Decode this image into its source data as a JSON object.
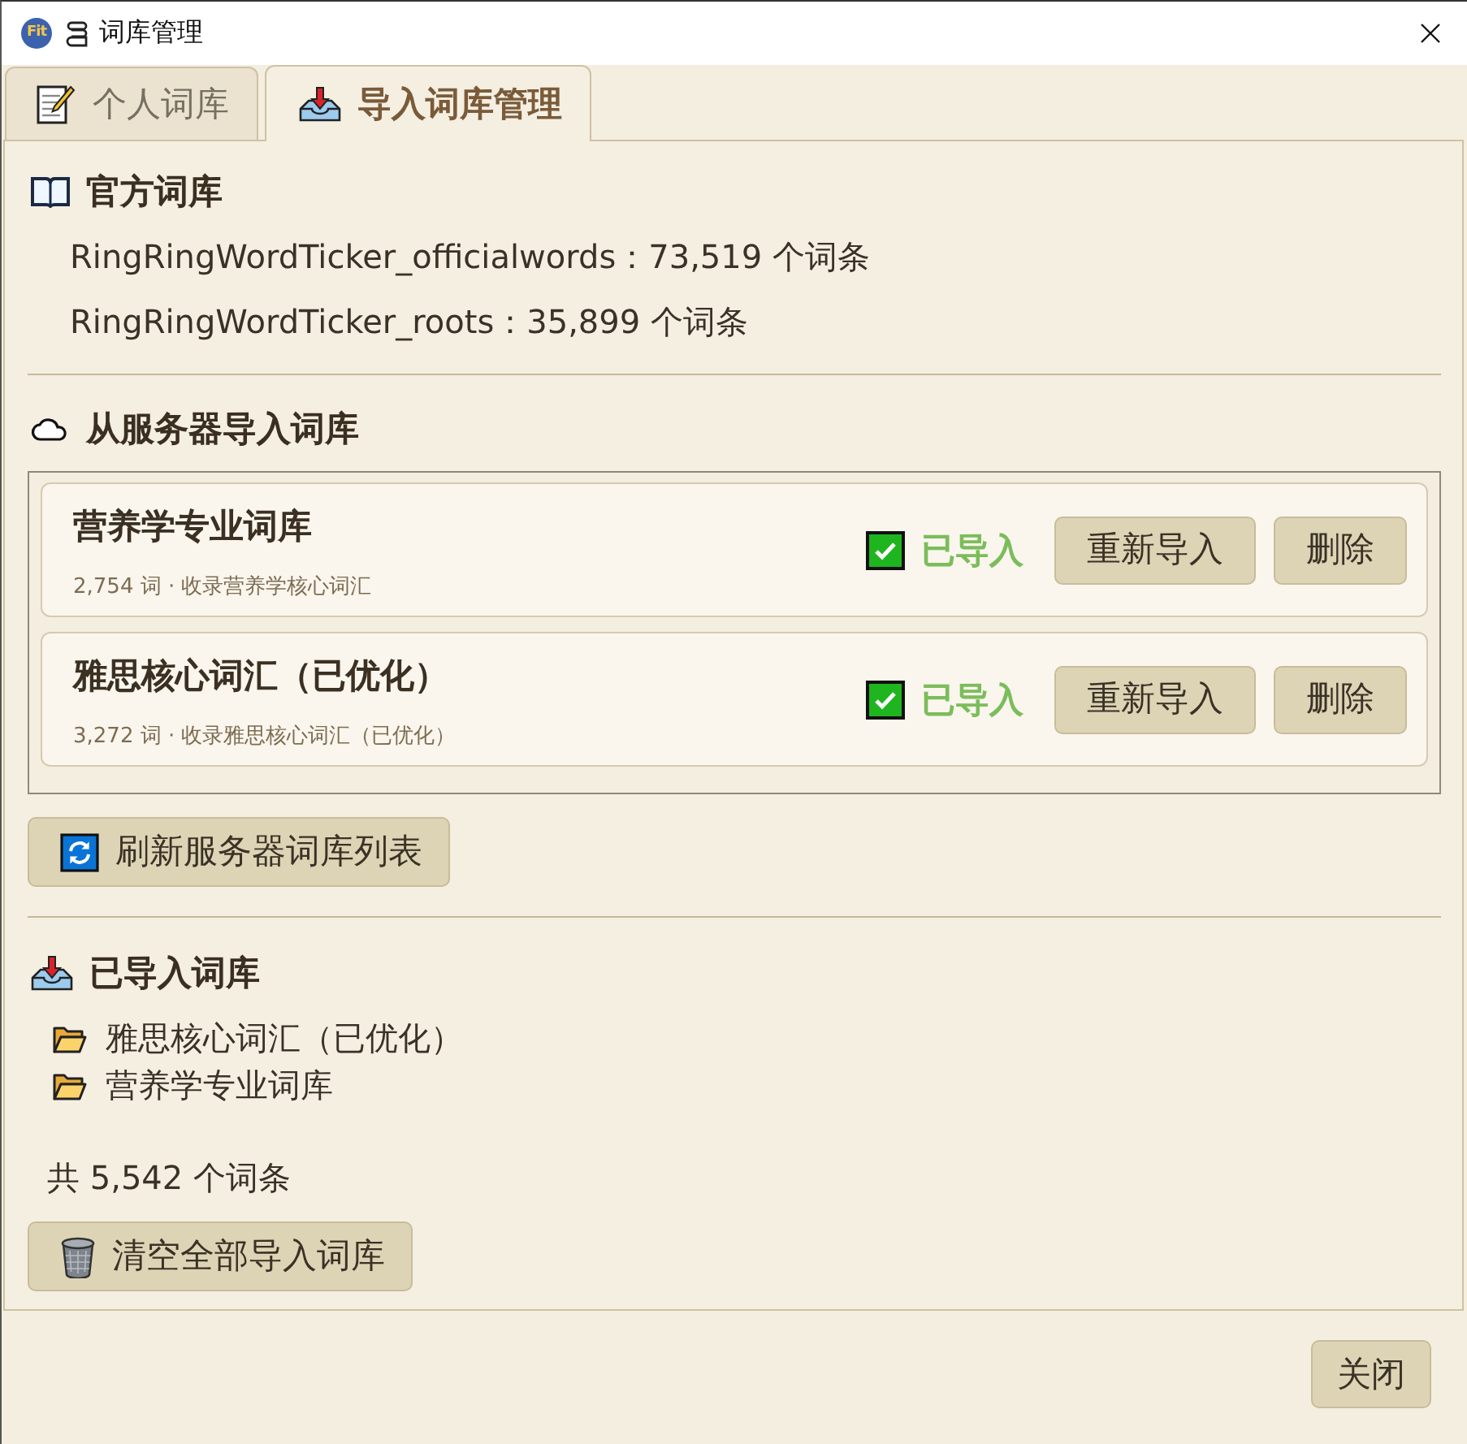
{
  "window": {
    "app_logo": "Fit",
    "title": "词库管理"
  },
  "tabs": [
    {
      "label": "个人词库",
      "selected": false
    },
    {
      "label": "导入词库管理",
      "selected": true
    }
  ],
  "official_section": {
    "title": "官方词库",
    "lines": [
      "RingRingWordTicker_officialwords：73,519 个词条",
      "RingRingWordTicker_roots：35,899 个词条"
    ]
  },
  "server_section": {
    "title": "从服务器导入词库",
    "items": [
      {
        "name": "营养学专业词库",
        "details": "2,754 词 · 收录营养学核心词汇",
        "imported": true,
        "status": "已导入",
        "buttons": [
          "重新导入",
          "删除"
        ]
      },
      {
        "name": "雅思核心词汇（已优化）",
        "details": "3,272 词 · 收录雅思核心词汇（已优化）",
        "imported": true,
        "status": "已导入",
        "buttons": [
          "重新导入",
          "删除"
        ]
      }
    ],
    "refresh_button": "刷新服务器词库列表"
  },
  "imported_section": {
    "title": "已导入词库",
    "items": [
      "雅思核心词汇（已优化）",
      "营养学专业词库"
    ],
    "total": "共 5,542 个词条",
    "clear_button": "清空全部导入词库"
  },
  "footer": {
    "buttons": [
      "关闭"
    ]
  }
}
